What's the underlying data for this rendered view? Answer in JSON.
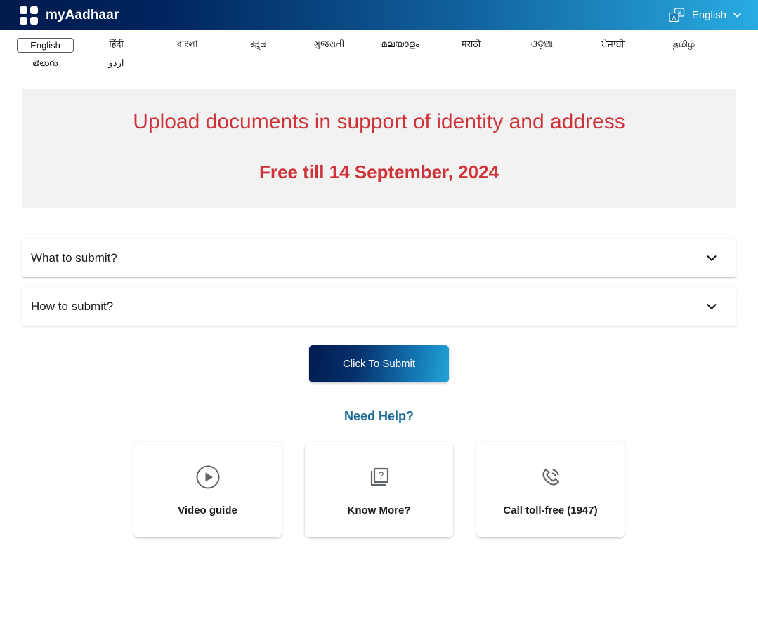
{
  "header": {
    "brand": "myAadhaar",
    "logo_icon": "grid-squares-logo",
    "language_selector": {
      "icon": "translate-icon",
      "value": "English",
      "chevron_icon": "chevron-down-icon"
    }
  },
  "language_tabs": {
    "selected": "English",
    "items": [
      {
        "label": "English"
      },
      {
        "label": "हिंदी"
      },
      {
        "label": "বাংলা"
      },
      {
        "label": "ಕನ್ನಡ"
      },
      {
        "label": "ગુજરાતી"
      },
      {
        "label": "മലയാളം"
      },
      {
        "label": "मराठी"
      },
      {
        "label": "ଓଡ଼ିଆ"
      },
      {
        "label": "ਪੰਜਾਬੀ"
      },
      {
        "label": "தமிழ்"
      },
      {
        "label": "తెలుగు"
      },
      {
        "label": "اردو"
      }
    ]
  },
  "banner": {
    "line1": "Upload documents in support of identity and address",
    "line2": "Free till 14 September, 2024",
    "text_color": "#cf3339",
    "background_color": "#f2f2f2"
  },
  "accordions": [
    {
      "title": "What to submit?",
      "chevron_icon": "chevron-down-icon"
    },
    {
      "title": "How to submit?",
      "chevron_icon": "chevron-down-icon"
    }
  ],
  "submit": {
    "label": "Click To Submit",
    "gradient_from": "#011b4f",
    "gradient_to": "#22a3d8"
  },
  "help": {
    "heading": "Need Help?",
    "heading_color": "#1a6a9a",
    "cards": [
      {
        "label": "Video guide",
        "icon": "play-circle-icon"
      },
      {
        "label": "Know More?",
        "icon": "question-cards-icon"
      },
      {
        "label": "Call toll-free (1947)",
        "icon": "phone-ring-icon"
      }
    ]
  }
}
